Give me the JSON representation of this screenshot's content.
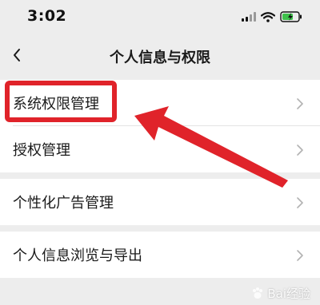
{
  "status_bar": {
    "time": "3:02"
  },
  "nav": {
    "title": "个人信息与权限"
  },
  "groups": [
    {
      "items": [
        {
          "label": "系统权限管理"
        },
        {
          "label": "授权管理"
        }
      ]
    },
    {
      "items": [
        {
          "label": "个性化广告管理"
        }
      ]
    },
    {
      "items": [
        {
          "label": "个人信息浏览与导出"
        }
      ]
    }
  ],
  "annotation": {
    "color": "#e0232a"
  },
  "watermark": {
    "text": "Bai经验"
  }
}
